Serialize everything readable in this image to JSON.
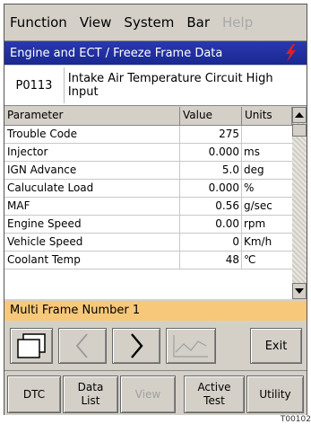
{
  "menu": [
    {
      "label": "Function",
      "enabled": true
    },
    {
      "label": "View",
      "enabled": true
    },
    {
      "label": "System",
      "enabled": true
    },
    {
      "label": "Bar",
      "enabled": true
    },
    {
      "label": "Help",
      "enabled": false
    }
  ],
  "title": "Engine and ECT / Freeze Frame Data",
  "dtc": {
    "code": "P0113",
    "description": "Intake Air Temperature Circuit High Input"
  },
  "table": {
    "headers": [
      "Parameter",
      "Value",
      "Units"
    ],
    "rows": [
      {
        "parameter": "Trouble Code",
        "value": "275",
        "units": ""
      },
      {
        "parameter": "Injector",
        "value": "0.000",
        "units": "ms"
      },
      {
        "parameter": "IGN Advance",
        "value": "5.0",
        "units": "deg"
      },
      {
        "parameter": "Caluculate Load",
        "value": "0.000",
        "units": "%"
      },
      {
        "parameter": "MAF",
        "value": "0.56",
        "units": "g/sec"
      },
      {
        "parameter": "Engine Speed",
        "value": "0.00",
        "units": "rpm"
      },
      {
        "parameter": "Vehicle Speed",
        "value": "0",
        "units": "Km/h"
      },
      {
        "parameter": "Coolant Temp",
        "value": "48",
        "units": "℃"
      }
    ]
  },
  "status": "Multi Frame Number 1",
  "toolbar": {
    "exit_label": "Exit"
  },
  "tabs": [
    {
      "label": "DTC",
      "enabled": true
    },
    {
      "label": "Data List",
      "enabled": true
    },
    {
      "label": "View",
      "enabled": false
    },
    {
      "label": "Active Test",
      "enabled": true
    },
    {
      "label": "Utility",
      "enabled": true
    }
  ],
  "figure_code": "T00102",
  "colors": {
    "titlebar": "#1f2ea0",
    "status": "#f7c87a",
    "panel": "#d4d0c8"
  }
}
